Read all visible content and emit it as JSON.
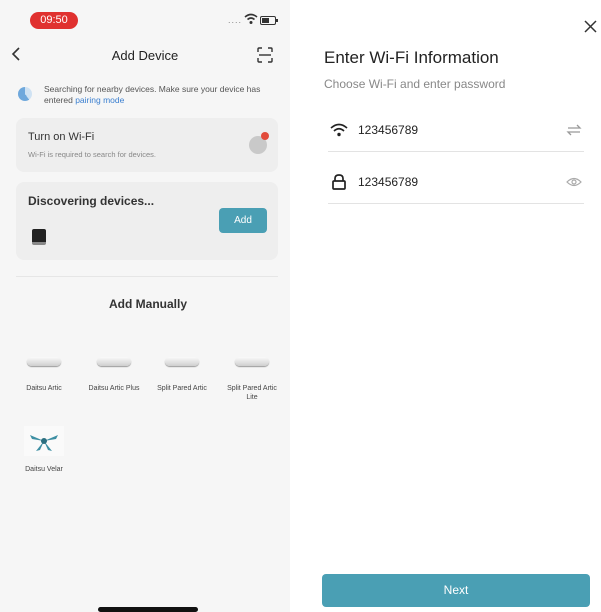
{
  "status_bar": {
    "time": "09:50",
    "signal_dots": "....",
    "wifi_icon": "wifi-icon",
    "battery_icon": "battery-icon"
  },
  "add_device": {
    "title": "Add Device",
    "back_icon": "chevron-left-icon",
    "scan_icon": "scan-icon",
    "searching_text": "Searching for nearby devices. Make sure your device has entered ",
    "pairing_link": "pairing mode",
    "wifi_card": {
      "title": "Turn on Wi-Fi",
      "subtitle": "Wi-Fi is required to search for devices."
    },
    "discovering": {
      "title": "Discovering devices...",
      "add_label": "Add"
    },
    "manual_title": "Add Manually",
    "manual_devices": [
      {
        "name": "Daitsu Artic"
      },
      {
        "name": "Daitsu Artic Plus"
      },
      {
        "name": "Split Pared Artic"
      },
      {
        "name": "Split Pared Artic Lite"
      },
      {
        "name": "Daitsu Velar"
      }
    ]
  },
  "wifi_info": {
    "title": "Enter Wi-Fi Information",
    "subtitle": "Choose Wi-Fi and enter password",
    "ssid": "123456789",
    "password": "123456789",
    "next_label": "Next",
    "accent": "#4a9fb4"
  }
}
